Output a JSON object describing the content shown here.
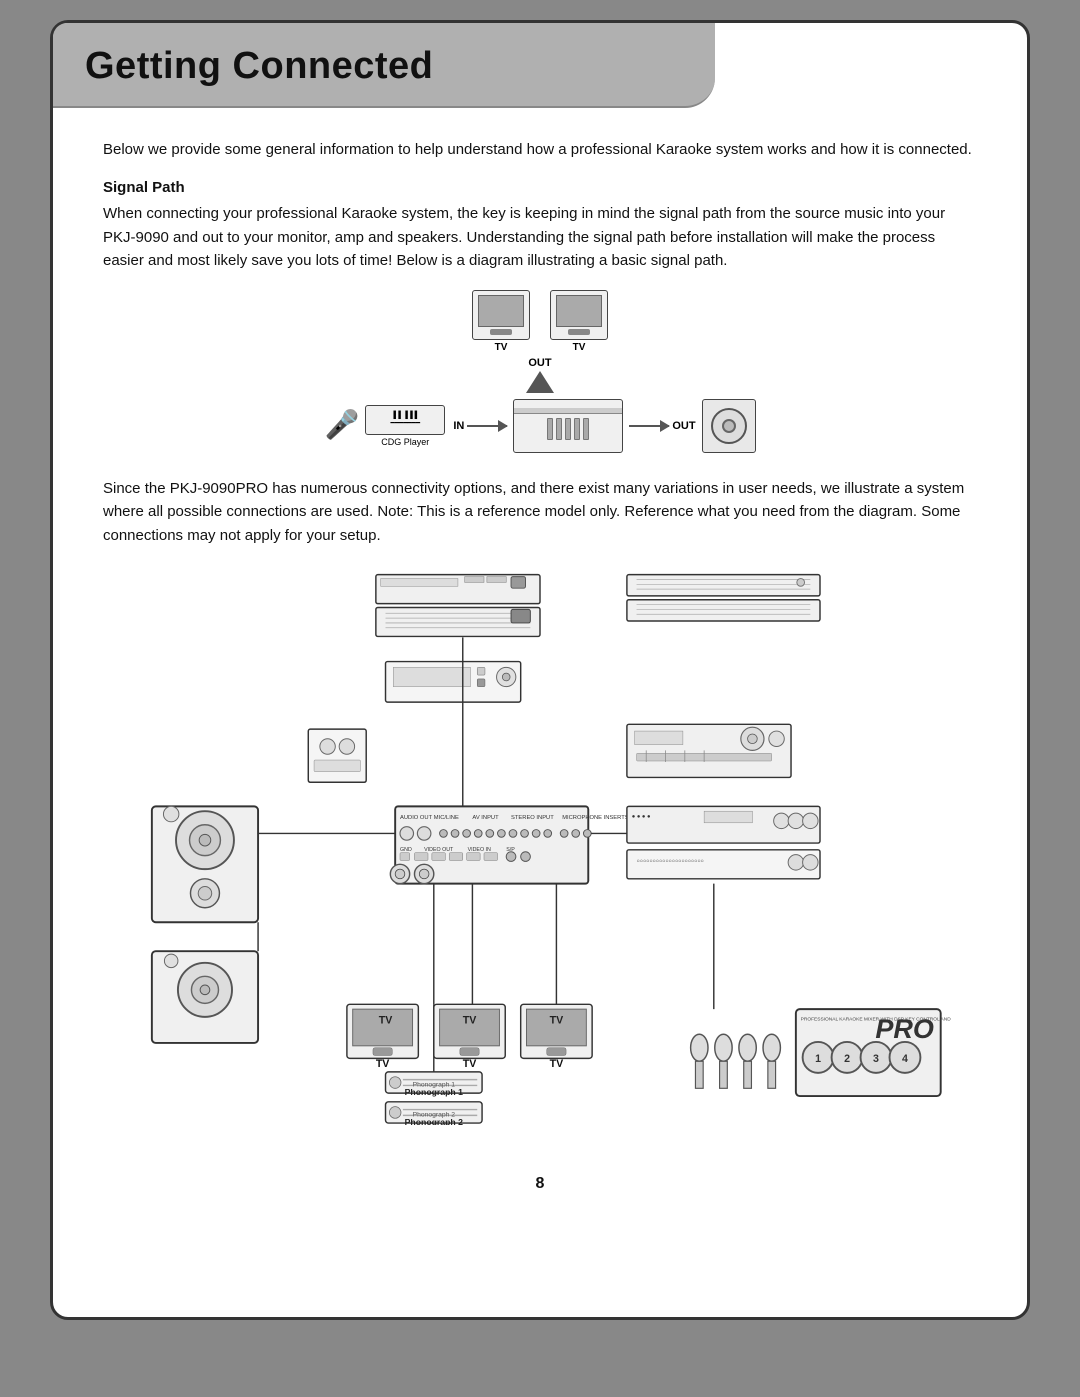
{
  "title": "Getting Connected",
  "intro": "Below we provide some general information to help understand how a professional Karaoke system works and how it is connected.",
  "signal_path_heading": "Signal Path",
  "signal_path_text": "When connecting your professional Karaoke system, the key is keeping in mind the signal path from the source music into your PKJ-9090 and out to your monitor, amp and speakers.  Understanding the signal path before installation will make the process easier and most likely save you lots of time!  Below is a diagram illustrating a basic signal path.",
  "labels": {
    "tv": "TV",
    "out": "OUT",
    "in": "IN",
    "cdg_player": "CDG Player",
    "phonograph1": "Phonograph 1",
    "phonograph2": "Phonograph 2"
  },
  "second_paragraph": "Since the PKJ-9090PRO has numerous connectivity options, and there exist many variations in user needs, we illustrate a system where all possible connections are used. Note: This is a reference model only. Reference what you need from the diagram. Some connections may not apply for your setup.",
  "page_number": "8"
}
